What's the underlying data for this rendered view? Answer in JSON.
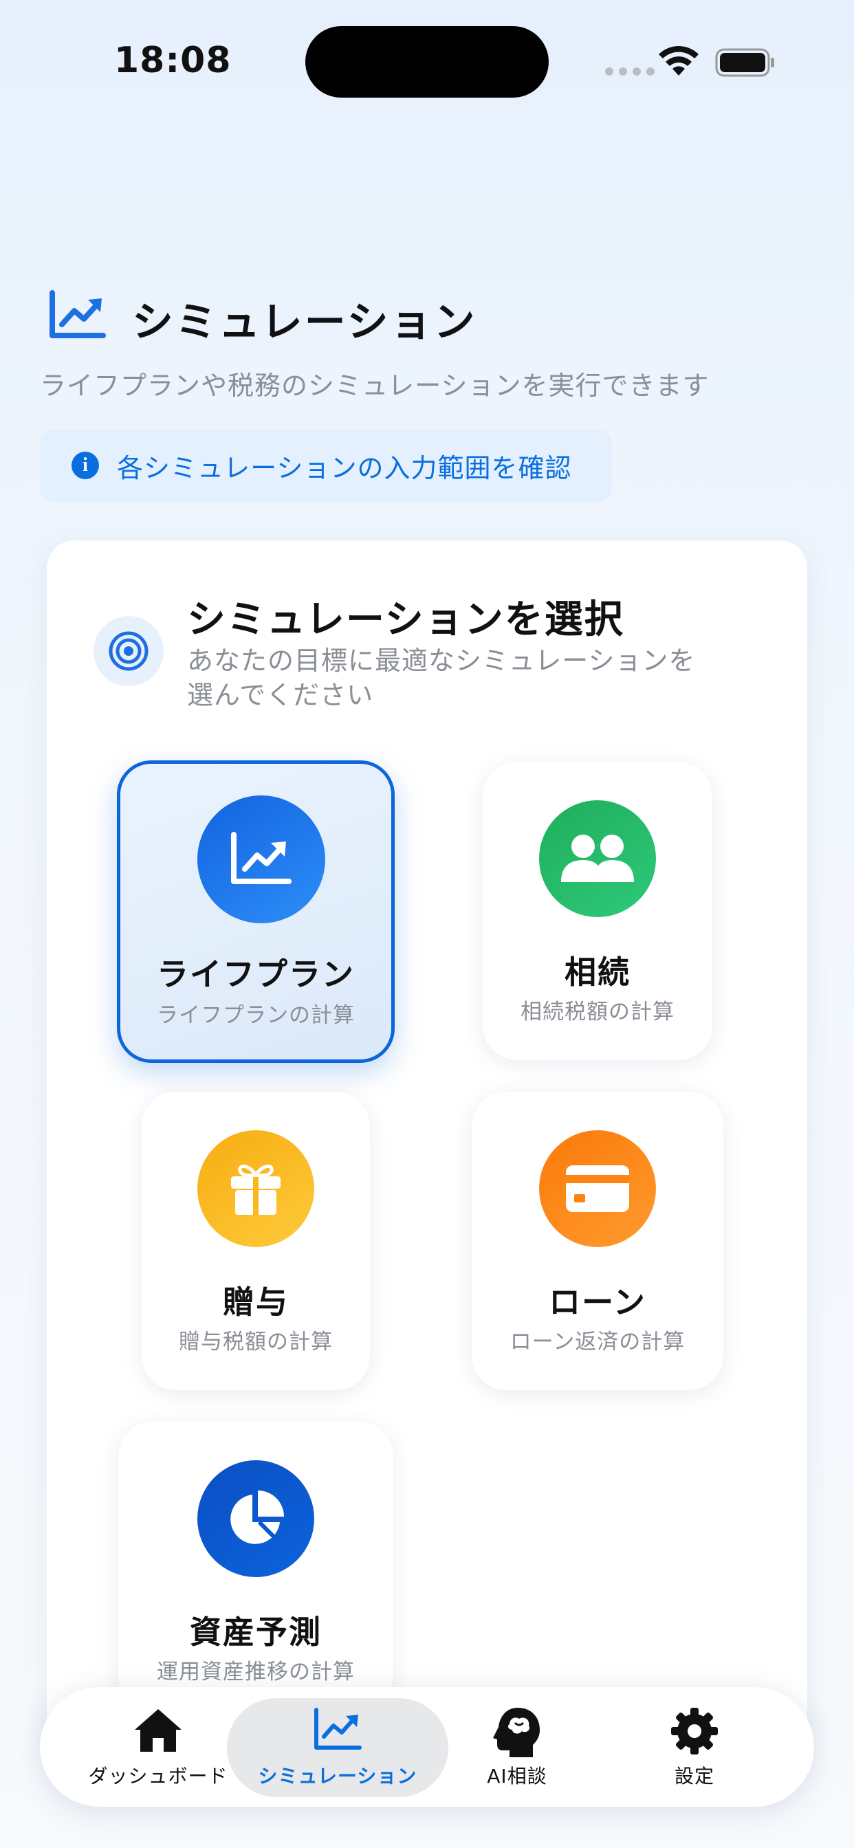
{
  "status_bar": {
    "time": "18:08"
  },
  "header": {
    "title": "シミュレーション",
    "subtitle": "ライフプランや税務のシミュレーションを実行できます",
    "info_banner": "各シミュレーションの入力範囲を確認"
  },
  "card": {
    "title": "シミュレーションを選択",
    "description_line1": "あなたの目標に最適なシミュレーションを",
    "description_line2": "選んでください"
  },
  "simulations": [
    {
      "label": "ライフプラン",
      "sub": "ライフプランの計算",
      "icon": "chart-line-icon",
      "color": "#1e78ea",
      "selected": true
    },
    {
      "label": "相続",
      "sub": "相続税額の計算",
      "icon": "users-icon",
      "color": "#22b765",
      "selected": false
    },
    {
      "label": "贈与",
      "sub": "贈与税額の計算",
      "icon": "gift-icon",
      "color": "#fbb91f",
      "selected": false
    },
    {
      "label": "ローン",
      "sub": "ローン返済の計算",
      "icon": "credit-card-icon",
      "color": "#fd8412",
      "selected": false
    },
    {
      "label": "資産予測",
      "sub": "運用資産推移の計算",
      "icon": "pie-chart-icon",
      "color": "#0a57cf",
      "selected": false
    }
  ],
  "tabs": [
    {
      "label": "ダッシュボード",
      "icon": "home-icon",
      "active": false
    },
    {
      "label": "シミュレーション",
      "icon": "chart-line-icon",
      "active": true
    },
    {
      "label": "AI相談",
      "icon": "brain-head-icon",
      "active": false
    },
    {
      "label": "設定",
      "icon": "gear-icon",
      "active": false
    }
  ],
  "colors": {
    "accent": "#0a6ee0",
    "muted_text": "#8a8e96"
  }
}
